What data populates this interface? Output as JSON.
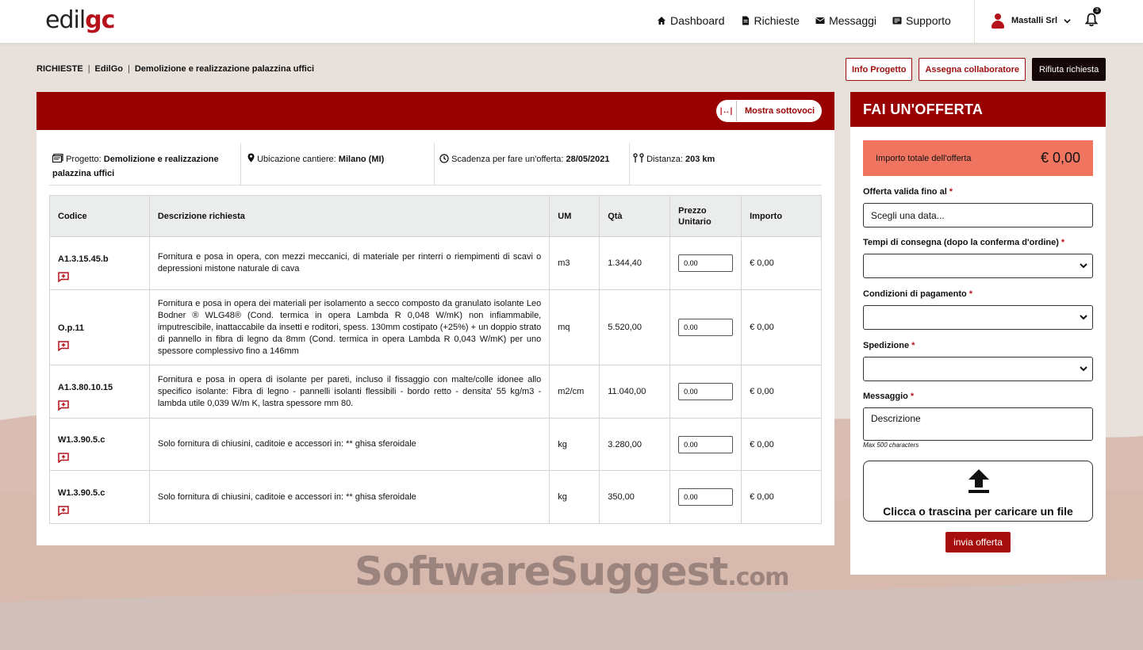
{
  "app": {
    "logo_left": "edil",
    "logo_right": "gc"
  },
  "nav": [
    {
      "label": "Dashboard",
      "icon": "home-icon"
    },
    {
      "label": "Richieste",
      "icon": "document-icon"
    },
    {
      "label": "Messaggi",
      "icon": "mail-icon"
    },
    {
      "label": "Supporto",
      "icon": "support-icon"
    }
  ],
  "user": {
    "name": "Mastalli Srl",
    "notifications": "3"
  },
  "breadcrumb": [
    "RICHIESTE",
    "EdilGo",
    "Demolizione e realizzazione palazzina uffici"
  ],
  "breadcrumb_sep": "|",
  "actions": {
    "info": "Info Progetto",
    "assign": "Assegna collaboratore",
    "reject": "Rifiuta richiesta"
  },
  "toggle_label": "Mostra sottovoci",
  "info": {
    "project_label": "Progetto:",
    "project_value": "Demolizione e realizzazione palazzina uffici",
    "location_label": "Ubicazione cantiere:",
    "location_value": "Milano (MI)",
    "deadline_label": "Scadenza per fare un'offerta:",
    "deadline_value": "28/05/2021",
    "distance_label": "Distanza:",
    "distance_value": "203 km"
  },
  "table": {
    "headers": [
      "Codice",
      "Descrizione richiesta",
      "UM",
      "Qtà",
      "Prezzo Unitario",
      "Importo"
    ],
    "rows": [
      {
        "code": "A1.3.15.45.b",
        "desc": "Fornitura e posa in opera, con mezzi meccanici, di materiale per rinterri o riempimenti di scavi o depressioni mistone naturale di cava",
        "um": "m3",
        "qty": "1.344,40",
        "price": "0.00",
        "amount": "€ 0,00"
      },
      {
        "code": "O.p.11",
        "desc": "Fornitura e posa in opera dei materiali per isolamento a secco composto da granulato isolante Leo Bodner ® WLG48® (Cond. termica in opera Lambda R 0,048 W/mK) non infiammabile, imputrescibile, inattaccabile da insetti e roditori, spess. 130mm costipato (+25%) + un doppio strato di pannello in fibra di legno da 8mm (Cond. termica in opera Lambda R 0,043 W/mK) per uno spessore complessivo fino a 146mm",
        "um": "mq",
        "qty": "5.520,00",
        "price": "0.00",
        "amount": "€ 0,00"
      },
      {
        "code": "A1.3.80.10.15",
        "desc": "Fornitura e posa in opera di isolante per pareti, incluso il fissaggio con malte/colle idonee allo specifico isolante: Fibra di legno - pannelli isolanti flessibili - bordo retto - densita' 55 kg/m3 - lambda utile 0,039 W/m K, lastra spessore mm 80.",
        "um": "m2/cm",
        "qty": "11.040,00",
        "price": "0.00",
        "amount": "€ 0,00"
      },
      {
        "code": "W1.3.90.5.c",
        "desc": "Solo fornitura di chiusini, caditoie e accessori in: ** ghisa sferoidale",
        "um": "kg",
        "qty": "3.280,00",
        "price": "0.00",
        "amount": "€ 0,00"
      },
      {
        "code": "W1.3.90.5.c",
        "desc": "Solo fornitura di chiusini, caditoie e accessori in: ** ghisa sferoidale",
        "um": "kg",
        "qty": "350,00",
        "price": "0.00",
        "amount": "€ 0,00"
      }
    ]
  },
  "offer": {
    "title": "FAI UN'OFFERTA",
    "total_label": "Importo totale dell'offerta",
    "total_value": "€ 0,00",
    "valid_label": "Offerta valida fino al",
    "valid_placeholder": "Scegli una data...",
    "delivery_label": "Tempi di consegna (dopo la conferma d'ordine)",
    "payment_label": "Condizioni di pagamento",
    "shipping_label": "Spedizione",
    "message_label": "Messaggio",
    "message_placeholder": "Descrizione",
    "hint": "Max 500 characters",
    "upload_label": "Clicca o trascina per caricare un file",
    "send": "invia offerta",
    "required": "*"
  },
  "watermark": {
    "main": "SoftwareSuggest",
    "domain": ".com"
  },
  "colors": {
    "brand": "#990000",
    "total_bg": "#f07560",
    "dark_button": "#160808"
  }
}
